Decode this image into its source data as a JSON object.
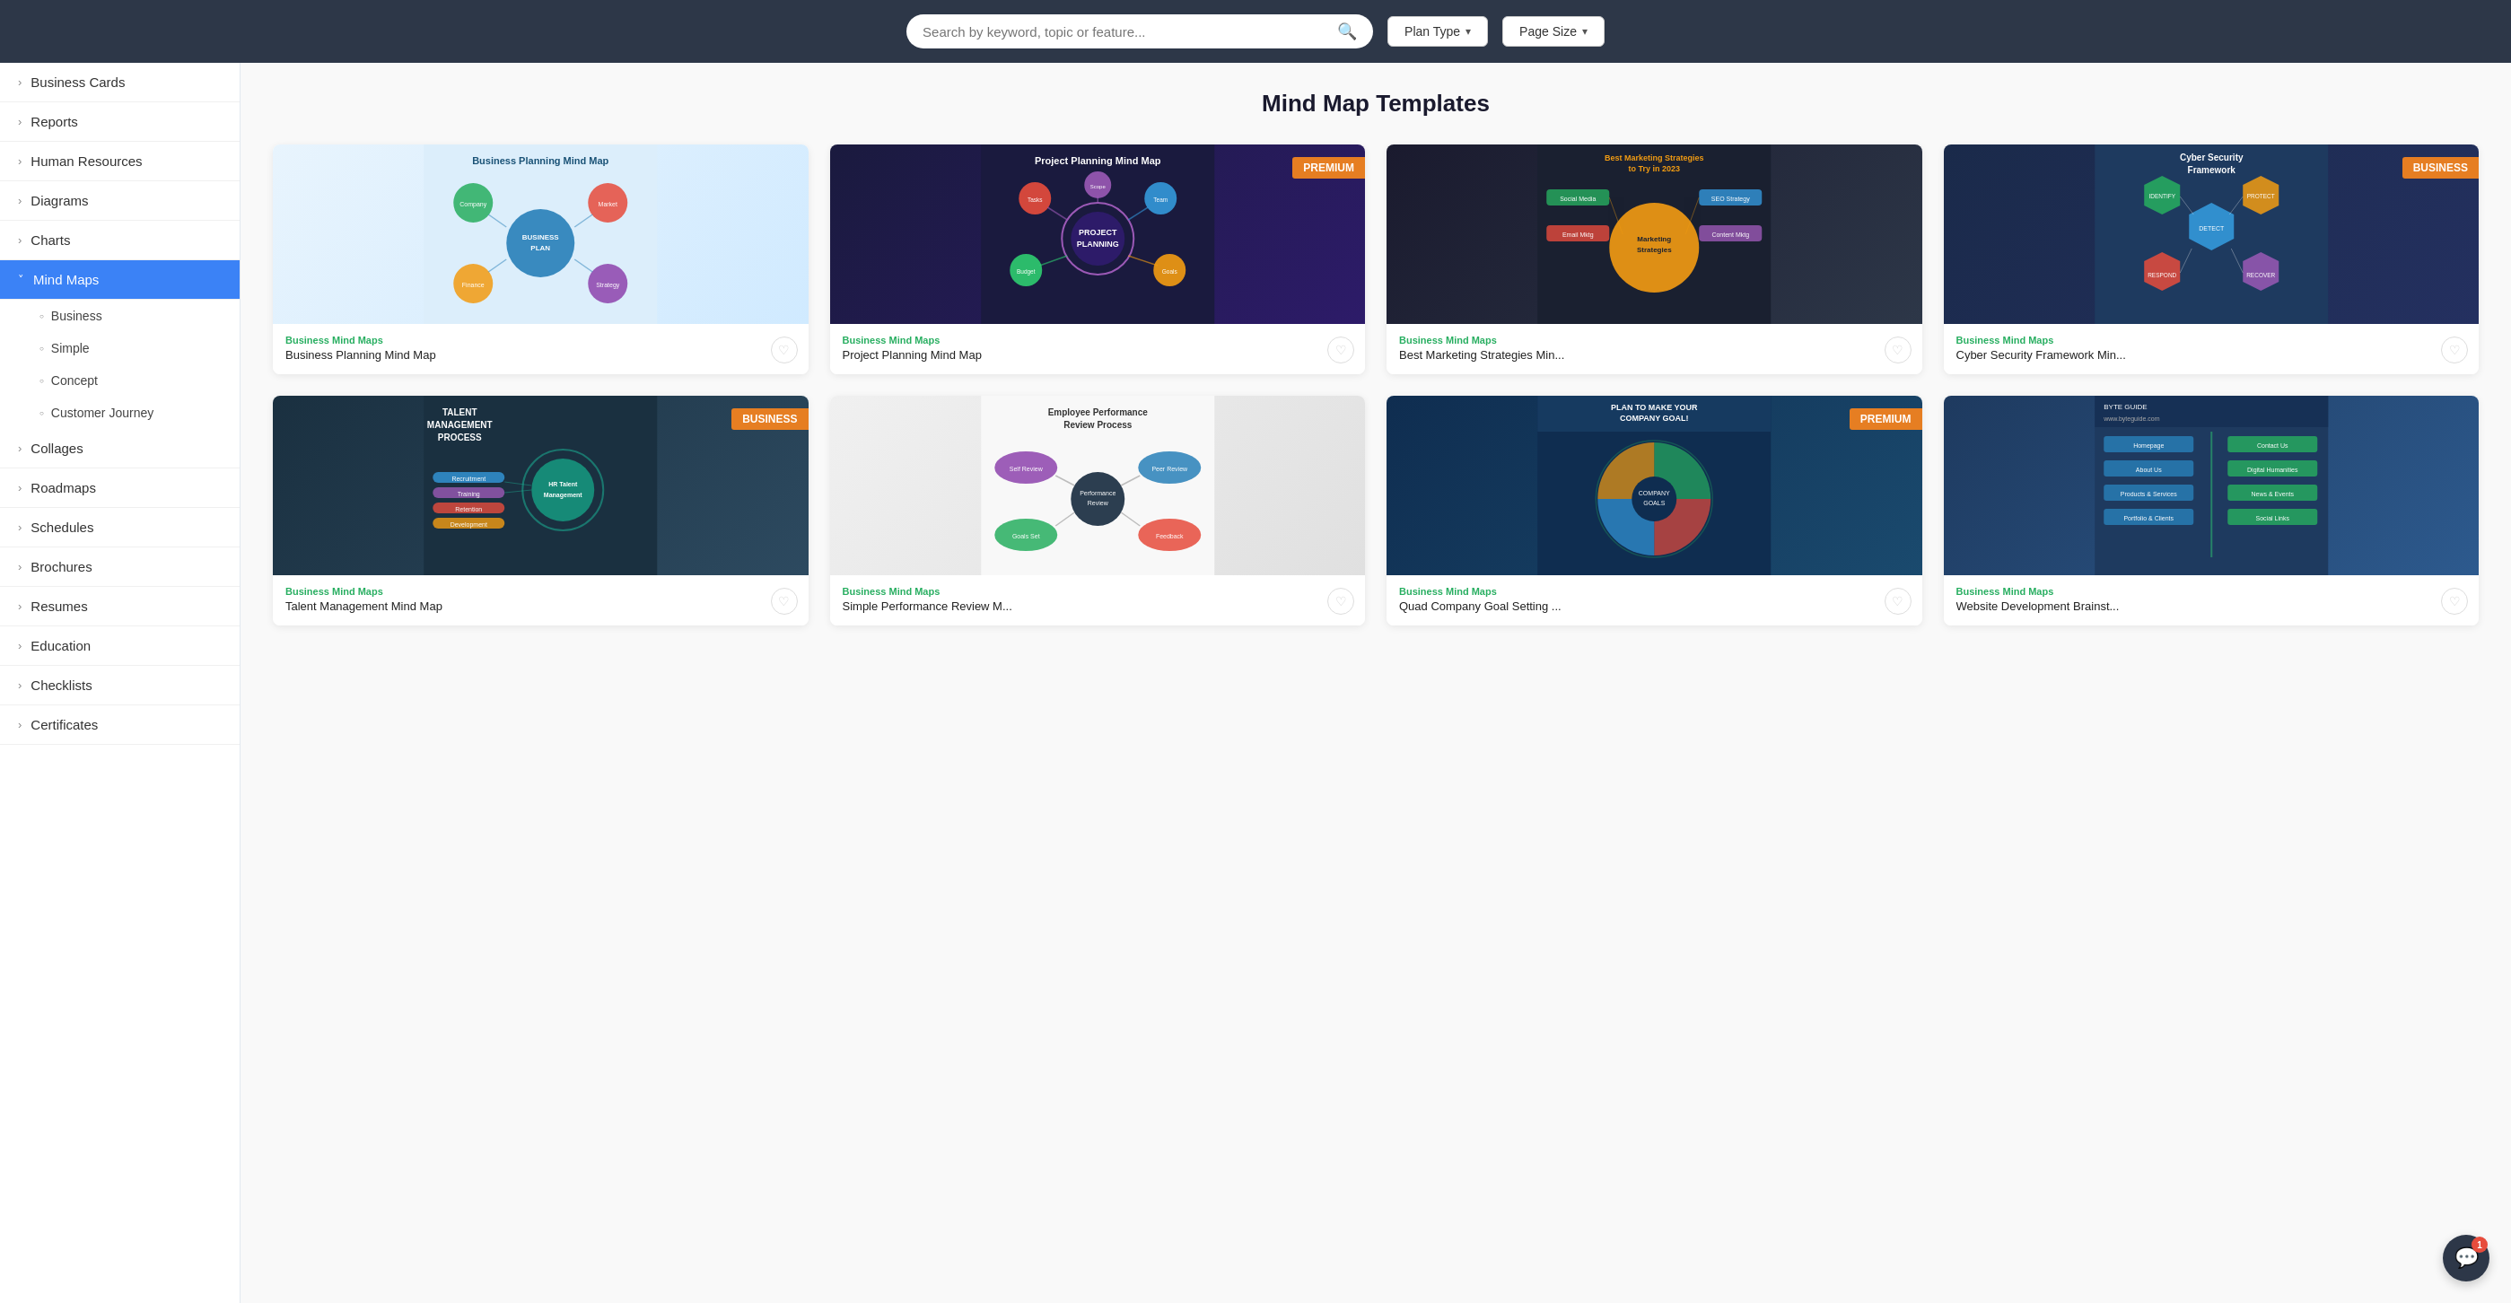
{
  "topbar": {
    "search_placeholder": "Search by keyword, topic or feature...",
    "plan_type_label": "Plan Type",
    "page_size_label": "Page Size"
  },
  "sidebar": {
    "items": [
      {
        "id": "business-cards",
        "label": "Business Cards",
        "expanded": false
      },
      {
        "id": "reports",
        "label": "Reports",
        "expanded": false
      },
      {
        "id": "human-resources",
        "label": "Human Resources",
        "expanded": false
      },
      {
        "id": "diagrams",
        "label": "Diagrams",
        "expanded": false
      },
      {
        "id": "charts",
        "label": "Charts",
        "expanded": false
      },
      {
        "id": "mind-maps",
        "label": "Mind Maps",
        "expanded": true,
        "active": true
      },
      {
        "id": "collages",
        "label": "Collages",
        "expanded": false
      },
      {
        "id": "roadmaps",
        "label": "Roadmaps",
        "expanded": false
      },
      {
        "id": "schedules",
        "label": "Schedules",
        "expanded": false
      },
      {
        "id": "brochures",
        "label": "Brochures",
        "expanded": false
      },
      {
        "id": "resumes",
        "label": "Resumes",
        "expanded": false
      },
      {
        "id": "education",
        "label": "Education",
        "expanded": false
      },
      {
        "id": "checklists",
        "label": "Checklists",
        "expanded": false
      },
      {
        "id": "certificates",
        "label": "Certificates",
        "expanded": false
      }
    ],
    "sub_items": [
      {
        "id": "business",
        "label": "Business"
      },
      {
        "id": "simple",
        "label": "Simple"
      },
      {
        "id": "concept",
        "label": "Concept"
      },
      {
        "id": "customer-journey",
        "label": "Customer Journey"
      }
    ]
  },
  "page": {
    "title": "Mind Map Templates"
  },
  "templates": [
    {
      "id": 1,
      "category": "Business Mind Maps",
      "name": "Business Planning Mind Map",
      "badge": null,
      "img_class": "img-1",
      "bg_color": "#dceefb",
      "accent": "#2980b9"
    },
    {
      "id": 2,
      "category": "Business Mind Maps",
      "name": "Project Planning Mind Map",
      "badge": "PREMIUM",
      "badge_type": "premium",
      "img_class": "img-2",
      "bg_color": "#1a1a3e",
      "accent": "#9b59b6"
    },
    {
      "id": 3,
      "category": "Business Mind Maps",
      "name": "Best Marketing Strategies Min...",
      "badge": null,
      "img_class": "img-3",
      "bg_color": "#1a2030",
      "accent": "#f39c12"
    },
    {
      "id": 4,
      "category": "Business Mind Maps",
      "name": "Cyber Security Framework Min...",
      "badge": "BUSINESS",
      "badge_type": "business",
      "img_class": "img-4",
      "bg_color": "#1e3a5f",
      "accent": "#3498db"
    },
    {
      "id": 5,
      "category": "Business Mind Maps",
      "name": "Talent Management Mind Map",
      "badge": "BUSINESS",
      "badge_type": "business",
      "img_class": "img-5",
      "bg_color": "#1a3040",
      "accent": "#1abc9c"
    },
    {
      "id": 6,
      "category": "Business Mind Maps",
      "name": "Simple Performance Review M...",
      "badge": null,
      "img_class": "img-6",
      "bg_color": "#f0f0f0",
      "accent": "#8e44ad"
    },
    {
      "id": 7,
      "category": "Business Mind Maps",
      "name": "Quad Company Goal Setting ...",
      "badge": "PREMIUM",
      "badge_type": "premium",
      "img_class": "img-7",
      "bg_color": "#0f2d50",
      "accent": "#27ae60"
    },
    {
      "id": 8,
      "category": "Business Mind Maps",
      "name": "Website Development Brainst...",
      "badge": null,
      "img_class": "img-8",
      "bg_color": "#1e3a5f",
      "accent": "#2ecc71"
    }
  ],
  "chat": {
    "badge": "1",
    "icon": "💬"
  }
}
